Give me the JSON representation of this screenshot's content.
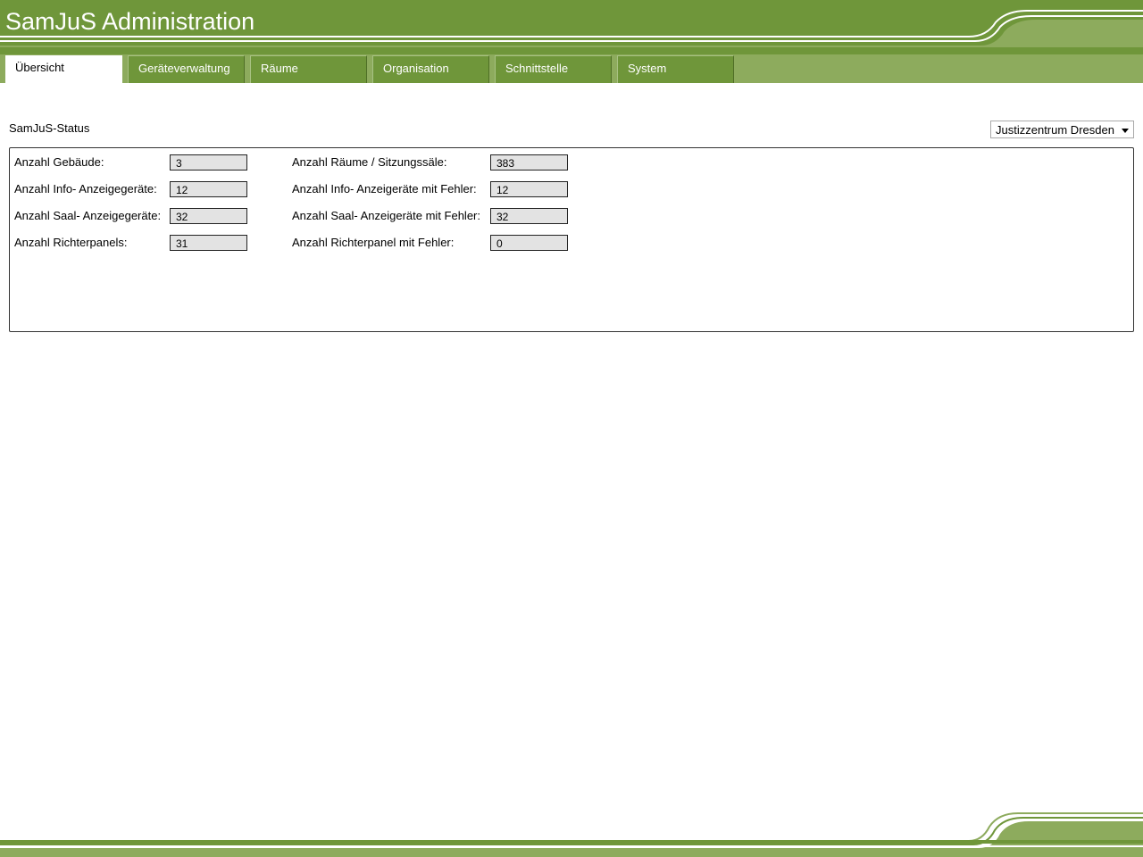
{
  "app": {
    "title": "SamJuS Administration"
  },
  "tabs": [
    {
      "label": "Übersicht",
      "active": true
    },
    {
      "label": "Geräteverwaltung",
      "active": false
    },
    {
      "label": "Räume",
      "active": false
    },
    {
      "label": "Organisation",
      "active": false
    },
    {
      "label": "Schnittstelle",
      "active": false
    },
    {
      "label": "System",
      "active": false
    }
  ],
  "section": {
    "title": "SamJuS-Status"
  },
  "site_select": {
    "value": "Justizzentrum Dresden"
  },
  "stats_left": [
    {
      "label": "Anzahl Gebäude:",
      "value": "3"
    },
    {
      "label": "Anzahl Info- Anzeigegeräte:",
      "value": "12"
    },
    {
      "label": "Anzahl Saal- Anzeigegeräte:",
      "value": "32"
    },
    {
      "label": "Anzahl Richterpanels:",
      "value": "31"
    }
  ],
  "stats_right": [
    {
      "label": "Anzahl Räume / Sitzungssäle:",
      "value": "383"
    },
    {
      "label": "Anzahl Info- Anzeigeräte mit Fehler:",
      "value": "12"
    },
    {
      "label": "Anzahl Saal- Anzeigeräte mit Fehler:",
      "value": "32"
    },
    {
      "label": "Anzahl Richterpanel mit Fehler:",
      "value": "0"
    }
  ],
  "colors": {
    "header_green": "#6f963a",
    "tabbar_green": "#8dab5d",
    "light_green": "#a8c283"
  }
}
